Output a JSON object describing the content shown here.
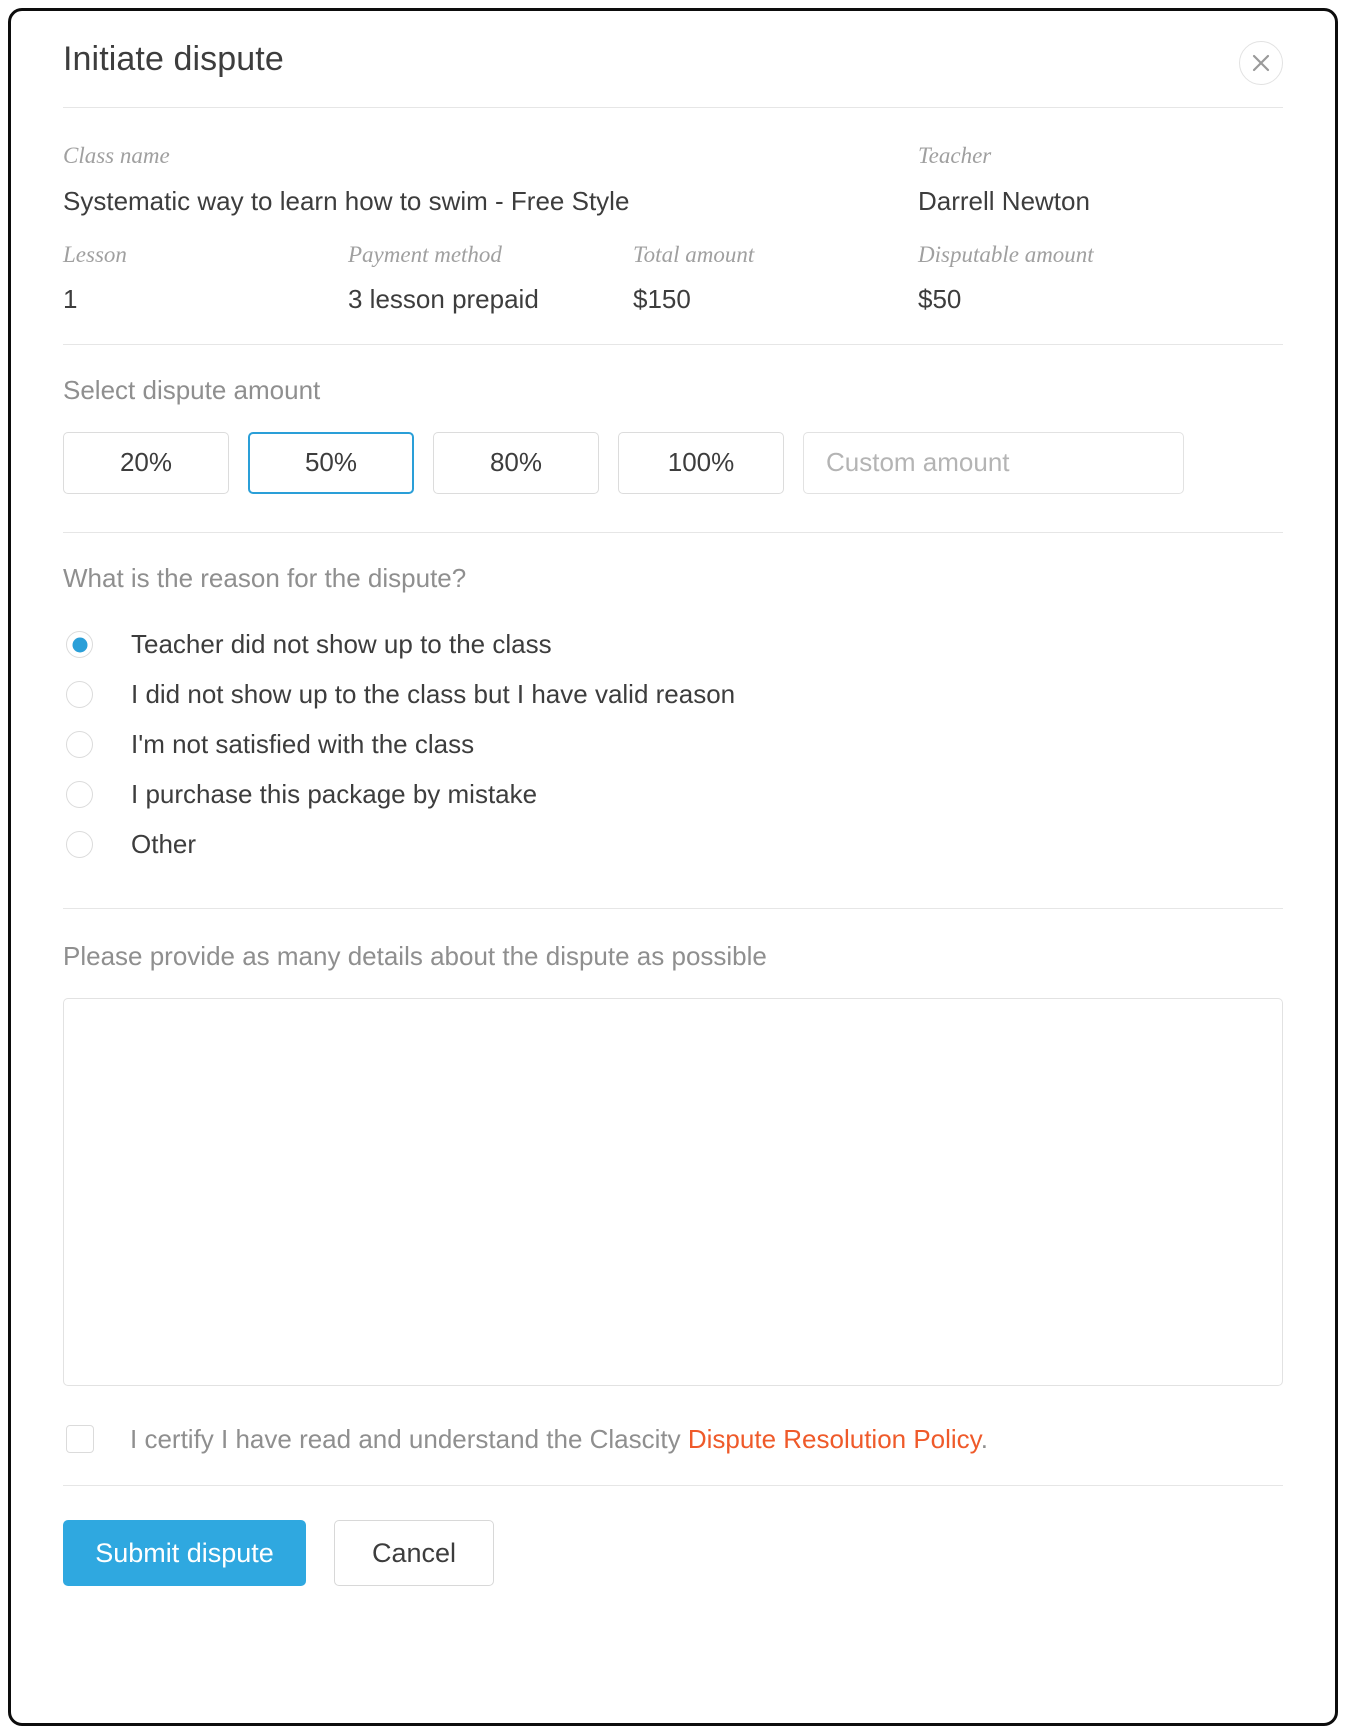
{
  "modal": {
    "title": "Initiate dispute",
    "close_icon": "close-icon"
  },
  "info": {
    "class_name_label": "Class name",
    "class_name_value": "Systematic way to learn how to swim - Free Style",
    "teacher_label": "Teacher",
    "teacher_value": "Darrell Newton",
    "lesson_label": "Lesson",
    "lesson_value": "1",
    "payment_method_label": "Payment method",
    "payment_method_value": "3 lesson prepaid",
    "total_amount_label": "Total amount",
    "total_amount_value": "$150",
    "disputable_amount_label": "Disputable amount",
    "disputable_amount_value": "$50"
  },
  "amount": {
    "section_label": "Select dispute amount",
    "options": [
      {
        "label": "20%",
        "selected": false
      },
      {
        "label": "50%",
        "selected": true
      },
      {
        "label": "80%",
        "selected": false
      },
      {
        "label": "100%",
        "selected": false
      }
    ],
    "custom_placeholder": "Custom amount",
    "custom_value": "",
    "selected_border_color": "#2a9fd8"
  },
  "reason": {
    "section_label": "What is the reason for the dispute?",
    "options": [
      {
        "label": "Teacher did not show up to the class",
        "checked": true
      },
      {
        "label": "I did not show up to the class but I have valid reason",
        "checked": false
      },
      {
        "label": "I'm not satisfied with the class",
        "checked": false
      },
      {
        "label": "I purchase this package by mistake",
        "checked": false
      },
      {
        "label": "Other",
        "checked": false
      }
    ]
  },
  "details": {
    "section_label": "Please provide as many details about the dispute as possible",
    "value": "",
    "placeholder": ""
  },
  "certify": {
    "checked": false,
    "text_before": "I certify I have read and understand the Clascity",
    "link_text": "Dispute Resolution Policy",
    "text_after": ".",
    "link_color": "#ef5a2a"
  },
  "footer": {
    "submit_label": "Submit dispute",
    "cancel_label": "Cancel",
    "submit_color": "#2fa8e0"
  }
}
